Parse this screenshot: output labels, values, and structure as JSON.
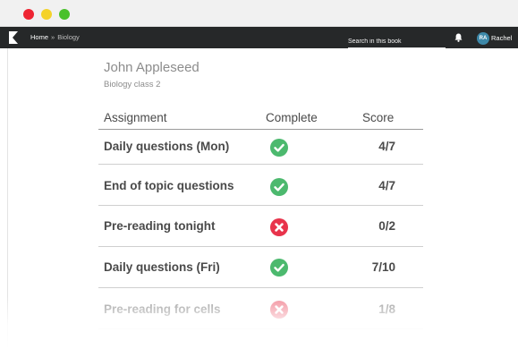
{
  "app": {
    "breadcrumb": {
      "home": "Home",
      "separator": "»",
      "current": "Biology"
    },
    "search": {
      "placeholder": "Search in this book"
    },
    "user": {
      "initials": "RA",
      "name": "Rachel"
    },
    "icons": {
      "logo": "brand-logo-icon",
      "bell": "bell-icon"
    },
    "colors": {
      "app_bar": "#262829",
      "complete": "#4cb96e",
      "incomplete": "#e8334b",
      "avatar": "#3d88a8"
    }
  },
  "student": {
    "name": "John Appleseed",
    "class": "Biology class 2"
  },
  "table": {
    "columns": {
      "assignment": "Assignment",
      "complete": "Complete",
      "score": "Score"
    },
    "rows": [
      {
        "assignment": "Daily questions (Mon)",
        "complete": true,
        "score": "4/7"
      },
      {
        "assignment": "End of topic questions",
        "complete": true,
        "score": "4/7"
      },
      {
        "assignment": "Pre-reading tonight",
        "complete": false,
        "score": "0/2"
      },
      {
        "assignment": "Daily questions (Fri)",
        "complete": true,
        "score": "7/10"
      },
      {
        "assignment": "Pre-reading for cells",
        "complete": false,
        "score": "1/8"
      }
    ]
  }
}
